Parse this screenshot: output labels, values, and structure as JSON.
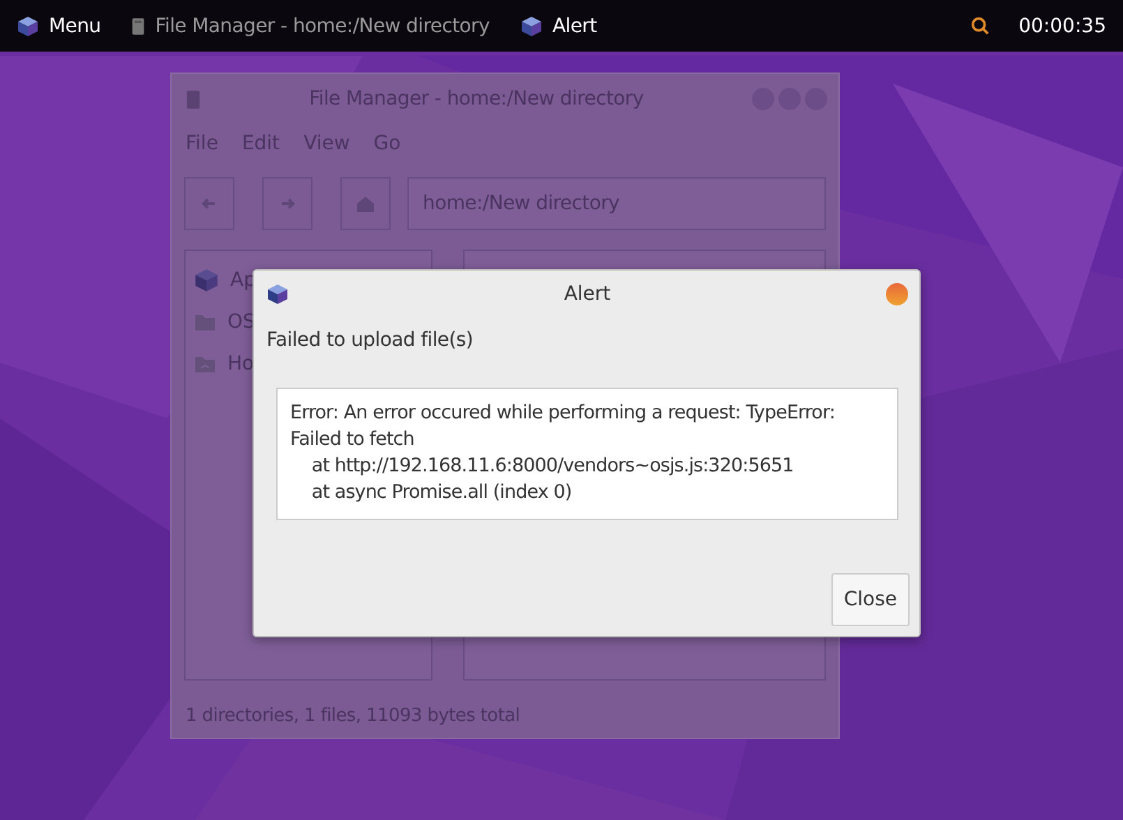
{
  "panel": {
    "menu_label": "Menu",
    "items": [
      {
        "label": "File Manager - home:/New directory",
        "kind": "file-manager",
        "focused": false
      },
      {
        "label": "Alert",
        "kind": "alert",
        "focused": true
      }
    ],
    "clock": "00:00:35"
  },
  "file_manager": {
    "title": "File Manager - home:/New directory",
    "menu": [
      "File",
      "Edit",
      "View",
      "Go"
    ],
    "address": "home:/New directory",
    "sidebar": [
      {
        "label": "Ap",
        "kind": "apps"
      },
      {
        "label": "OS",
        "kind": "folder"
      },
      {
        "label": "Ho",
        "kind": "home"
      }
    ],
    "status_bar": "1 directories, 1 files, 11093 bytes total"
  },
  "alert": {
    "title": "Alert",
    "message": "Failed to upload file(s)",
    "details": [
      "Error: An error occured while performing a request: TypeError:",
      "Failed to fetch",
      "    at http://192.168.11.6:8000/vendors~osjs.js:320:5651",
      "    at async Promise.all (index 0)"
    ],
    "button": "Close"
  }
}
